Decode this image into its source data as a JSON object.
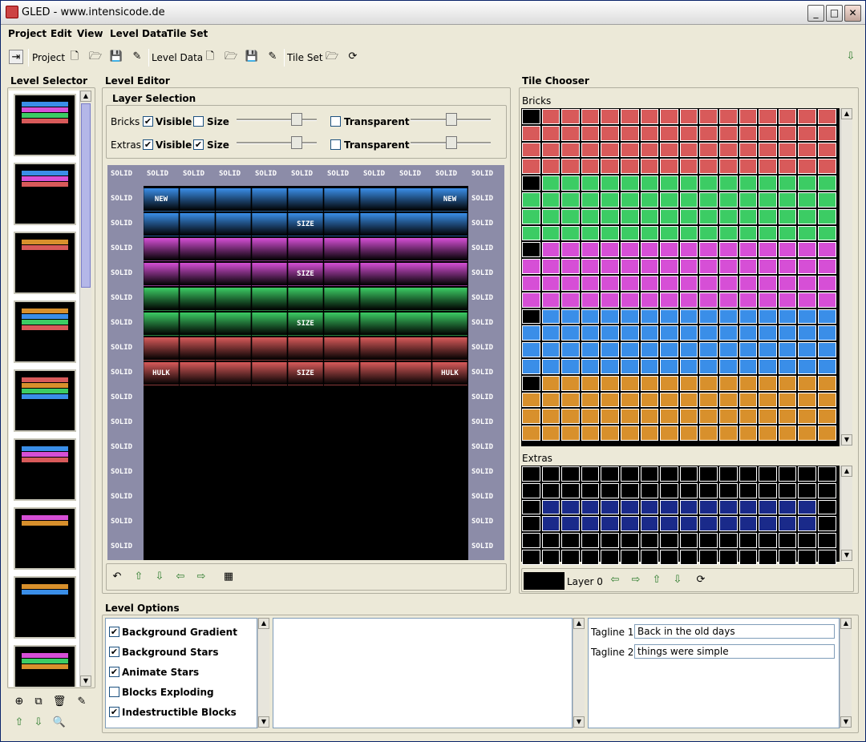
{
  "window": {
    "title": "GLED - www.intensicode.de"
  },
  "menu": [
    "Project",
    "Edit",
    "View",
    "Level Data",
    "Tile Set"
  ],
  "toolbar": {
    "project_label": "Project",
    "level_data_label": "Level Data",
    "tile_set_label": "Tile Set"
  },
  "level_selector": {
    "title": "Level Selector"
  },
  "level_editor": {
    "title": "Level Editor",
    "layer_selection_title": "Layer Selection",
    "layers": [
      {
        "name": "Bricks",
        "visible_label": "Visible",
        "visible": true,
        "size_label": "Size",
        "size": false,
        "transparent_label": "Transparent",
        "transparent": false
      },
      {
        "name": "Extras",
        "visible_label": "Visible",
        "visible": true,
        "size_label": "Size",
        "size": true,
        "transparent_label": "Transparent",
        "transparent": false
      }
    ],
    "border_text": "SOLID",
    "brick_labels": {
      "new": "NEW",
      "size": "SIZE",
      "hulk": "HULK"
    }
  },
  "tile_chooser": {
    "title": "Tile Chooser",
    "bricks_label": "Bricks",
    "extras_label": "Extras",
    "layer_label": "Layer 0"
  },
  "level_options": {
    "title": "Level Options",
    "options": [
      {
        "label": "Background Gradient",
        "checked": true
      },
      {
        "label": "Background Stars",
        "checked": true
      },
      {
        "label": "Animate Stars",
        "checked": true
      },
      {
        "label": "Blocks Exploding",
        "checked": false
      },
      {
        "label": "Indestructible Blocks",
        "checked": true
      }
    ],
    "tagline1_label": "Tagline 1",
    "tagline1_value": "Back in the old days",
    "tagline2_label": "Tagline 2",
    "tagline2_value": "things were simple"
  },
  "colors": {
    "blue": "#3a8ee8",
    "pink": "#d64fd6",
    "green": "#3ccc64",
    "red": "#d85a5a",
    "orange": "#d8902c",
    "border": "#8c8ca8"
  }
}
